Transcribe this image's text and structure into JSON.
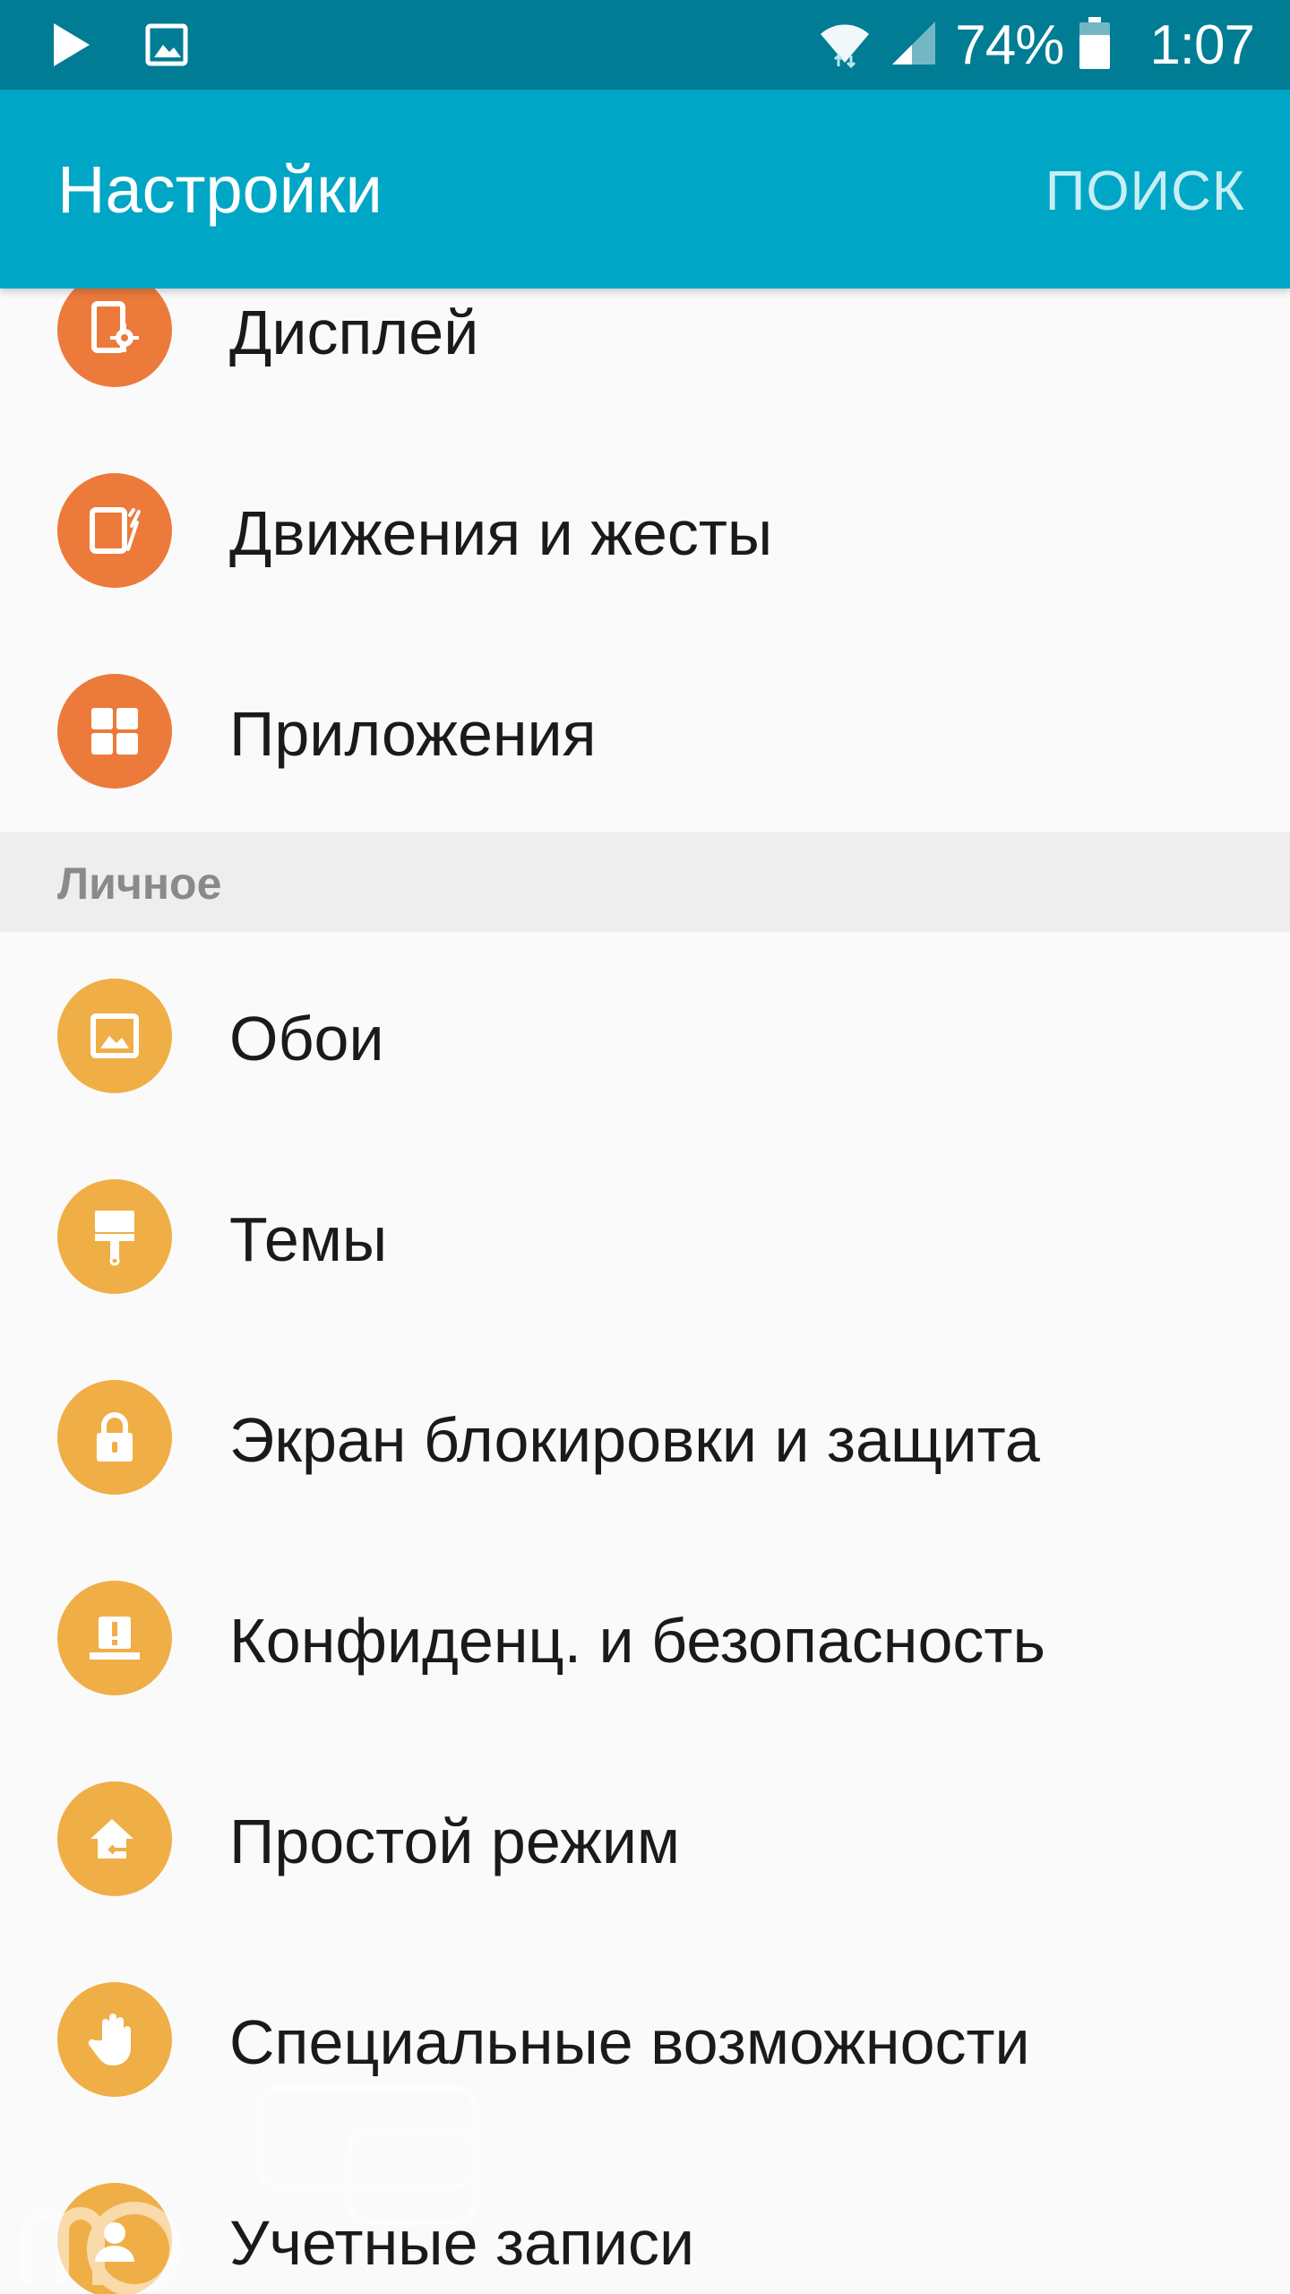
{
  "status_bar": {
    "battery": "74%",
    "time": "1:07",
    "icons": [
      "play-store-icon",
      "gallery-icon",
      "wifi-icon",
      "signal-icon",
      "battery-icon"
    ]
  },
  "app_bar": {
    "title": "Настройки",
    "action": "ПОИСК"
  },
  "items_top": [
    {
      "label": "Дисплей",
      "icon": "display-settings-icon",
      "color": "#ec7a3b"
    },
    {
      "label": "Движения и жесты",
      "icon": "motion-gestures-icon",
      "color": "#ec7a3b"
    },
    {
      "label": "Приложения",
      "icon": "apps-icon",
      "color": "#ec7a3b"
    }
  ],
  "section_personal": {
    "label": "Личное"
  },
  "items_personal": [
    {
      "label": "Обои",
      "icon": "wallpaper-icon",
      "color": "#f0ae46"
    },
    {
      "label": "Темы",
      "icon": "themes-brush-icon",
      "color": "#f0ae46"
    },
    {
      "label": "Экран блокировки и защита",
      "icon": "lock-icon",
      "color": "#f0ae46"
    },
    {
      "label": "Конфиденц. и безопасность",
      "icon": "privacy-safety-icon",
      "color": "#f0ae46"
    },
    {
      "label": "Простой режим",
      "icon": "easy-mode-icon",
      "color": "#f0ae46"
    },
    {
      "label": "Специальные возможности",
      "icon": "accessibility-hand-icon",
      "color": "#f0ae46"
    },
    {
      "label": "Учетные записи",
      "icon": "accounts-icon",
      "color": "#f0ae46"
    }
  ]
}
